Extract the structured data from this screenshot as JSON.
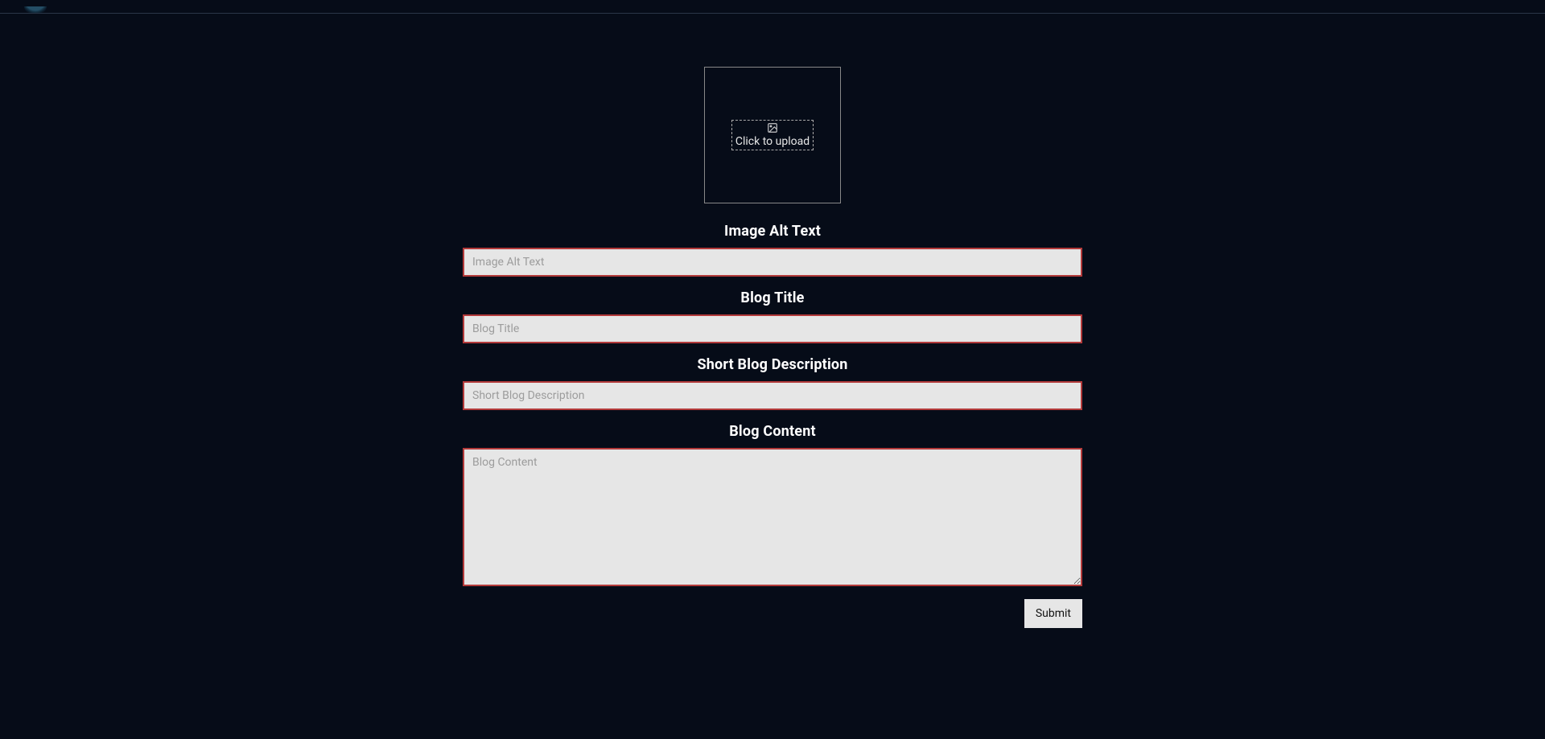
{
  "upload": {
    "label": "Click to upload"
  },
  "fields": {
    "alt": {
      "label": "Image Alt Text",
      "placeholder": "Image Alt Text",
      "value": ""
    },
    "title": {
      "label": "Blog Title",
      "placeholder": "Blog Title",
      "value": ""
    },
    "short": {
      "label": "Short Blog Description",
      "placeholder": "Short Blog Description",
      "value": ""
    },
    "content": {
      "label": "Blog Content",
      "placeholder": "Blog Content",
      "value": ""
    }
  },
  "submit": {
    "label": "Submit"
  }
}
